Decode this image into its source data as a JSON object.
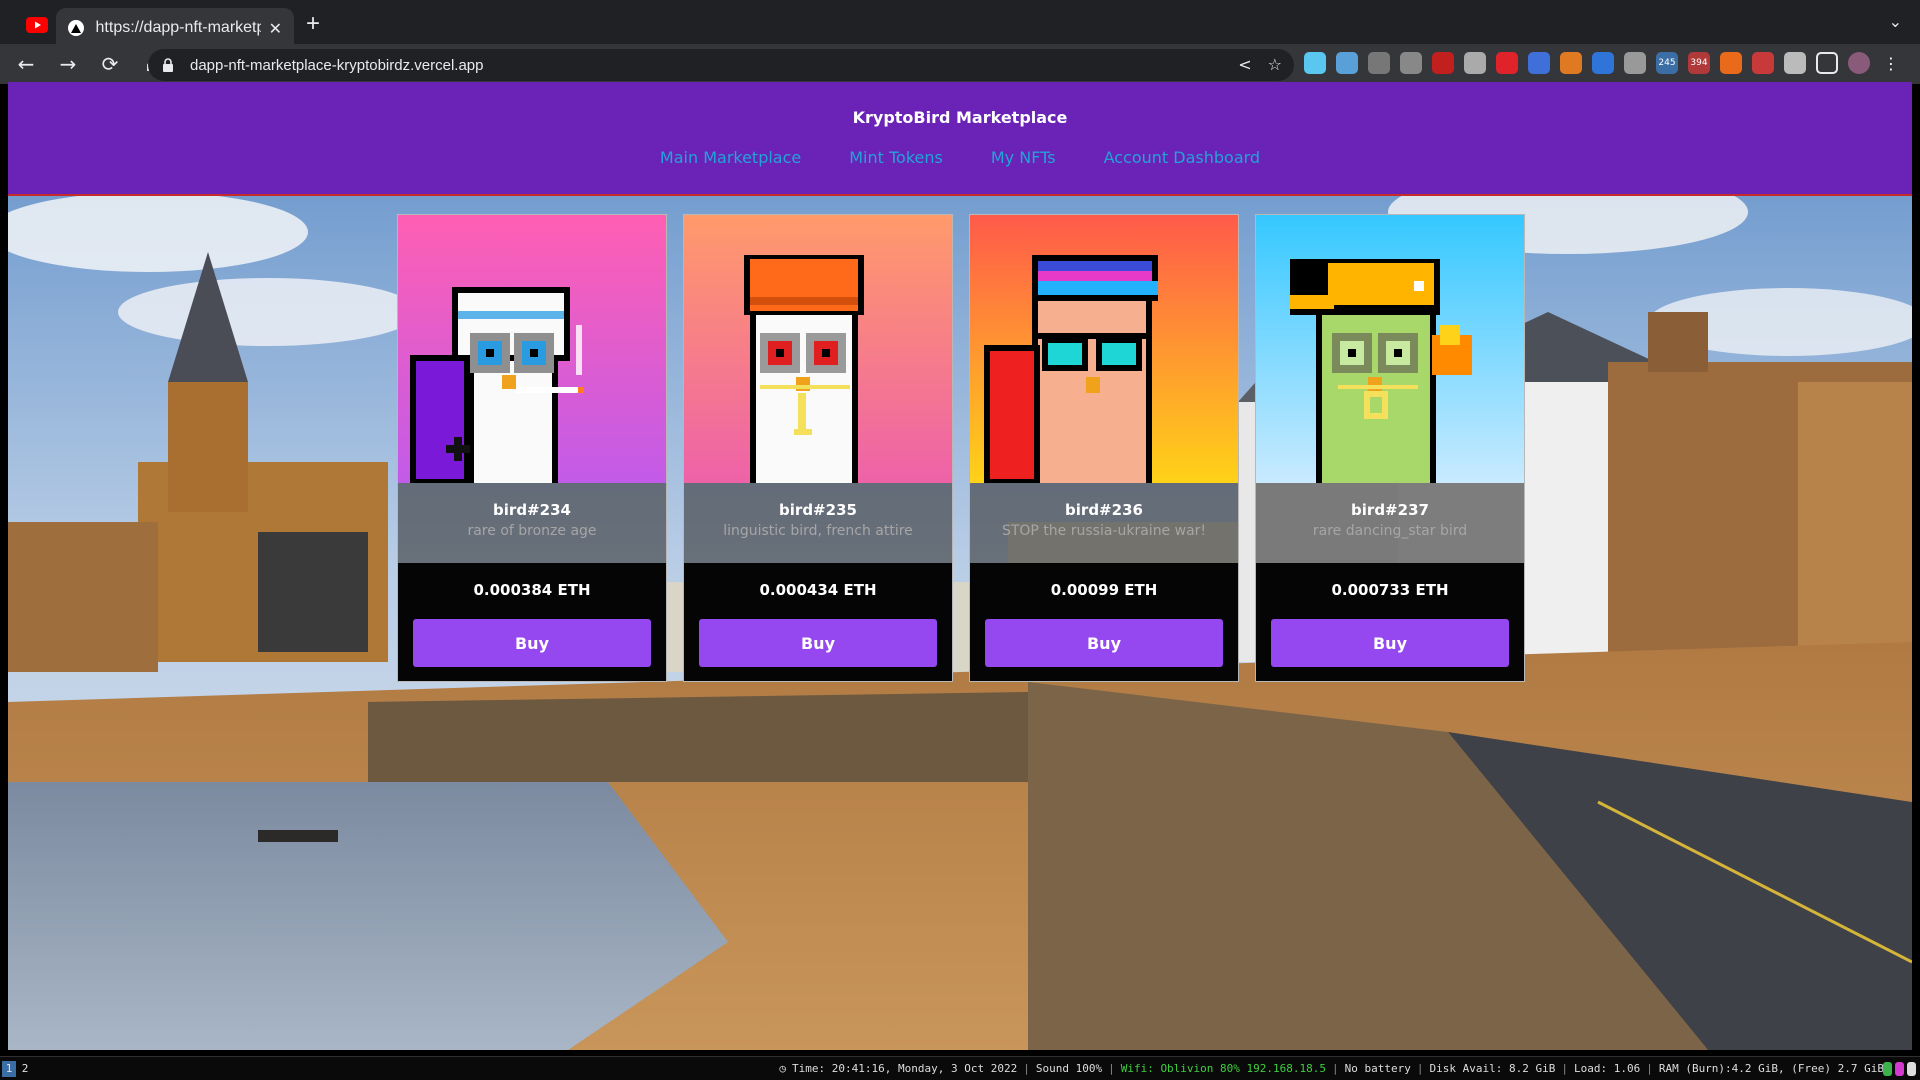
{
  "browser": {
    "tab_title": "https://dapp-nft-marketplace",
    "tab_close": "✕",
    "new_tab": "+",
    "url": "dapp-nft-marketplace-kryptobirdz.vercel.app",
    "extensions": [
      "react-devtools-icon",
      "photo-icon",
      "glasses-icon",
      "gear-icon",
      "ublock-icon",
      "circle-icon",
      "youtube-icon",
      "bird-icon",
      "fox-icon",
      "bar-icon",
      "cube-icon",
      "calendar-icon",
      "calendar-badge-icon",
      "flame-icon",
      "shield-icon",
      "puzzle-icon"
    ],
    "badges": [
      "245",
      "394"
    ]
  },
  "site": {
    "brand": "KryptoBird Marketplace",
    "nav": [
      "Main Marketplace",
      "Mint Tokens",
      "My NFTs",
      "Account Dashboard"
    ]
  },
  "cards": [
    {
      "name": "bird#234",
      "description": "rare of bronze age",
      "price": "0.000384 ETH",
      "buy_label": "Buy"
    },
    {
      "name": "bird#235",
      "description": "linguistic bird, french attire",
      "price": "0.000434 ETH",
      "buy_label": "Buy"
    },
    {
      "name": "bird#236",
      "description": "STOP the russia-ukraine war!",
      "price": "0.00099 ETH",
      "buy_label": "Buy"
    },
    {
      "name": "bird#237",
      "description": "rare dancing_star bird",
      "price": "0.000733 ETH",
      "buy_label": "Buy"
    }
  ],
  "taskbar": {
    "workspaces": [
      "1",
      "2"
    ],
    "status": {
      "time": "Time: 20:41:16, Monday, 3 Oct 2022",
      "sound": "Sound 100%",
      "wifi": "Wifi: Oblivion 80% 192.168.18.5",
      "battery": "No battery",
      "disk": "Disk Avail: 8.2 GiB",
      "load": "Load: 1.06",
      "ram": "RAM (Burn):4.2 GiB, (Free) 2.7 GiB"
    }
  },
  "colors": {
    "header": "#6a23b6",
    "nav_link": "#22a3d8",
    "buy_button": "#9547f0"
  }
}
